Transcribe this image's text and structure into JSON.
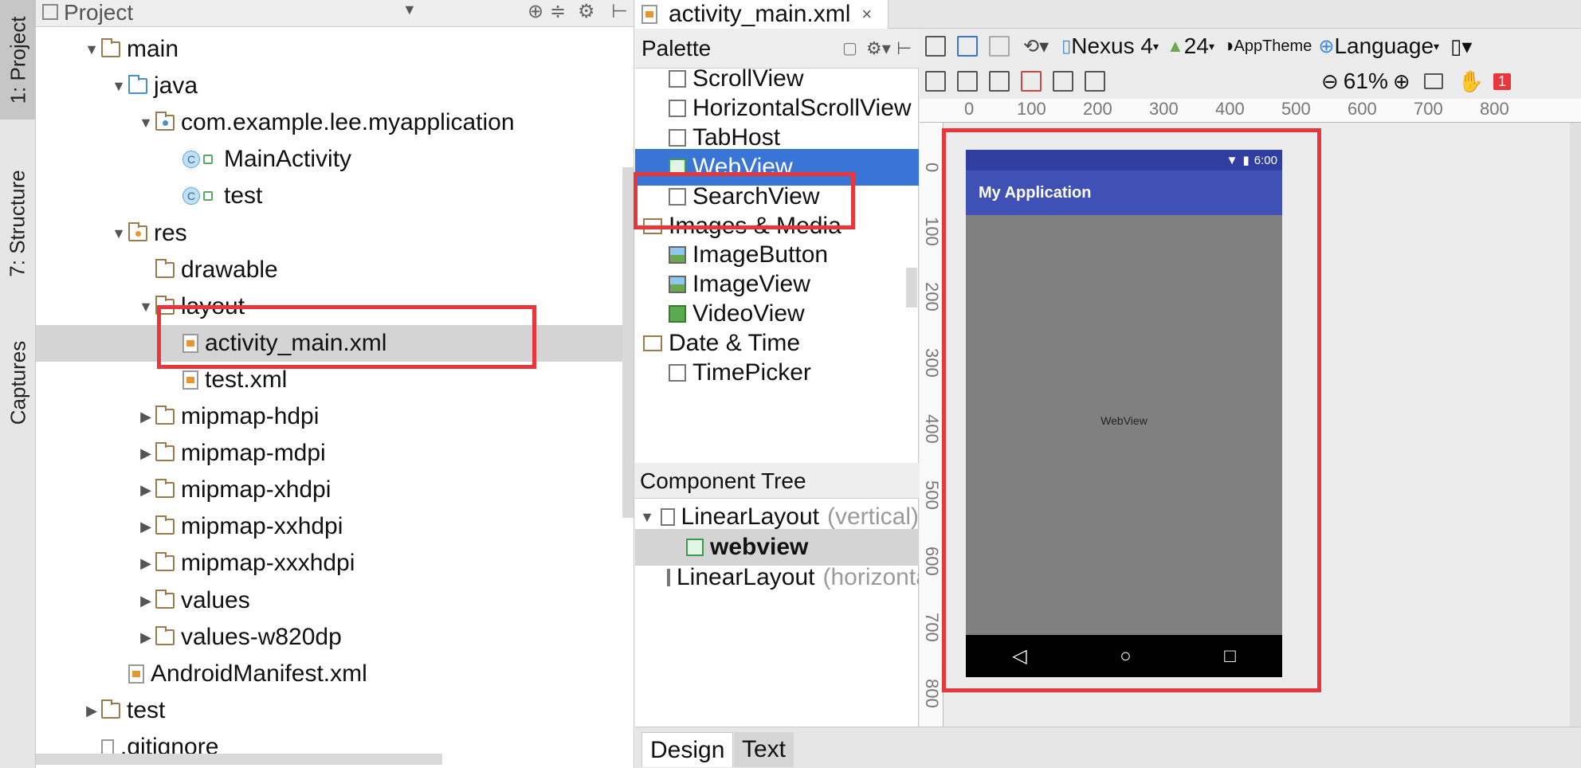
{
  "left_strip": {
    "tabs": [
      {
        "label": "1: Project",
        "active": true
      },
      {
        "label": "7: Structure",
        "active": false
      },
      {
        "label": "Captures",
        "active": false
      }
    ]
  },
  "project": {
    "title": "Project",
    "tree": [
      {
        "label": "main",
        "kind": "folder",
        "depth": 3,
        "arrow": "▼"
      },
      {
        "label": "java",
        "kind": "folder-blue",
        "depth": 4,
        "arrow": "▼"
      },
      {
        "label": "com.example.lee.myapplication",
        "kind": "package",
        "depth": 5,
        "arrow": "▼"
      },
      {
        "label": "MainActivity",
        "kind": "class",
        "depth": 6,
        "arrow": ""
      },
      {
        "label": "test",
        "kind": "class",
        "depth": 6,
        "arrow": ""
      },
      {
        "label": "res",
        "kind": "folder-res",
        "depth": 4,
        "arrow": "▼"
      },
      {
        "label": "drawable",
        "kind": "folder",
        "depth": 5,
        "arrow": ""
      },
      {
        "label": "layout",
        "kind": "folder",
        "depth": 5,
        "arrow": "▼"
      },
      {
        "label": "activity_main.xml",
        "kind": "xml",
        "depth": 6,
        "arrow": "",
        "selected": true
      },
      {
        "label": "test.xml",
        "kind": "xml",
        "depth": 6,
        "arrow": ""
      },
      {
        "label": "mipmap-hdpi",
        "kind": "folder",
        "depth": 5,
        "arrow": "▶"
      },
      {
        "label": "mipmap-mdpi",
        "kind": "folder",
        "depth": 5,
        "arrow": "▶"
      },
      {
        "label": "mipmap-xhdpi",
        "kind": "folder",
        "depth": 5,
        "arrow": "▶"
      },
      {
        "label": "mipmap-xxhdpi",
        "kind": "folder",
        "depth": 5,
        "arrow": "▶"
      },
      {
        "label": "mipmap-xxxhdpi",
        "kind": "folder",
        "depth": 5,
        "arrow": "▶"
      },
      {
        "label": "values",
        "kind": "folder",
        "depth": 5,
        "arrow": "▶"
      },
      {
        "label": "values-w820dp",
        "kind": "folder",
        "depth": 5,
        "arrow": "▶"
      },
      {
        "label": "AndroidManifest.xml",
        "kind": "manifest",
        "depth": 4,
        "arrow": ""
      },
      {
        "label": "test",
        "kind": "folder",
        "depth": 3,
        "arrow": "▶"
      },
      {
        "label": ".gitignore",
        "kind": "file",
        "depth": 3,
        "arrow": ""
      }
    ]
  },
  "editor": {
    "tab_label": "activity_main.xml",
    "close_glyph": "×"
  },
  "palette": {
    "title": "Palette",
    "items": [
      {
        "label": "ScrollView",
        "kind": "widget"
      },
      {
        "label": "HorizontalScrollView",
        "kind": "widget"
      },
      {
        "label": "TabHost",
        "kind": "widget"
      },
      {
        "label": "WebView",
        "kind": "green",
        "selected": true
      },
      {
        "label": "SearchView",
        "kind": "widget"
      },
      {
        "label": "Images & Media",
        "kind": "group"
      },
      {
        "label": "ImageButton",
        "kind": "img"
      },
      {
        "label": "ImageView",
        "kind": "img"
      },
      {
        "label": "VideoView",
        "kind": "vid"
      },
      {
        "label": "Date & Time",
        "kind": "group"
      },
      {
        "label": "TimePicker",
        "kind": "widget"
      }
    ]
  },
  "component_tree": {
    "title": "Component Tree",
    "rows": [
      {
        "label": "LinearLayout",
        "suffix": "(vertical)",
        "arrow": "▼",
        "indent": 0
      },
      {
        "label": "webview",
        "suffix": "",
        "arrow": "",
        "indent": 1,
        "selected": true
      },
      {
        "label": "LinearLayout",
        "suffix": "(horizontal)",
        "arrow": "",
        "indent": 1
      }
    ]
  },
  "toolbar": {
    "device": "Nexus 4",
    "api": "24",
    "theme": "AppTheme",
    "language": "Language",
    "zoom": "61%",
    "warnings": "1"
  },
  "ruler": {
    "top": [
      "0",
      "100",
      "200",
      "300",
      "400",
      "500",
      "600",
      "700",
      "800"
    ],
    "left": [
      "0",
      "100",
      "200",
      "300",
      "400",
      "500",
      "600",
      "700",
      "800"
    ]
  },
  "phone": {
    "time": "6:00",
    "app_title": "My Application",
    "webview_label": "WebView",
    "nav": [
      "◁",
      "○",
      "□"
    ]
  },
  "bottom_tabs": {
    "design": "Design",
    "text": "Text"
  },
  "colors": {
    "accent_red": "#e8363d",
    "selection_blue": "#3875d7",
    "app_bar": "#3f51b5"
  }
}
